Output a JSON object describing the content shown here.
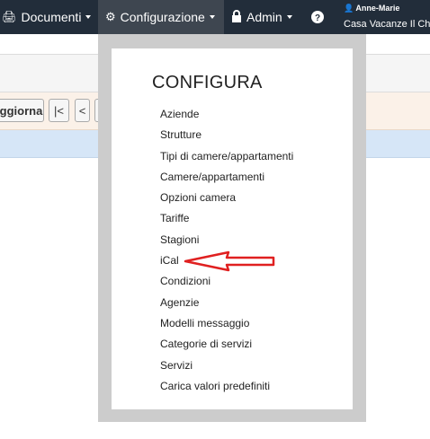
{
  "navbar": {
    "documenti": {
      "label": "Documenti",
      "icon": "print-icon"
    },
    "configurazione": {
      "label": "Configurazione",
      "icon": "gear-icon"
    },
    "admin": {
      "label": "Admin",
      "icon": "lock-icon"
    },
    "help_icon": "question-icon",
    "user": {
      "name": "Anne-Marie",
      "property": "Casa Vacanze Il Chi",
      "icon": "user-icon"
    }
  },
  "toolbar": {
    "update_label": "ggiorna",
    "first_label": "|<",
    "prev_label": "<",
    "next_label": ">"
  },
  "menu": {
    "title": "CONFIGURA",
    "items": [
      "Aziende",
      "Strutture",
      "Tipi di camere/appartamenti",
      "Camere/appartamenti",
      "Opzioni camera",
      "Tariffe",
      "Stagioni",
      "iCal",
      "Condizioni",
      "Agenzie",
      "Modelli messaggio",
      "Categorie di servizi",
      "Servizi",
      "Carica valori predefiniti"
    ]
  },
  "colors": {
    "navbar": "#222d3a",
    "active_nav": "#3e4650",
    "overlay": "#cccccc",
    "arrow": "#e02020"
  }
}
